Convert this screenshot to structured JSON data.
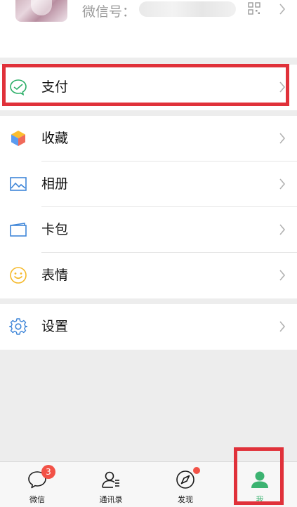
{
  "profile": {
    "wechat_id_label": "微信号："
  },
  "menu": {
    "pay": "支付",
    "favorites": "收藏",
    "album": "相册",
    "cards": "卡包",
    "stickers": "表情",
    "settings": "设置"
  },
  "tabbar": {
    "chats": "微信",
    "chats_badge": "3",
    "contacts": "通讯录",
    "discover": "发现",
    "me": "我"
  },
  "colors": {
    "accent_green": "#3cb371",
    "highlight_red": "#e0313a",
    "badge_red": "#f25247"
  }
}
